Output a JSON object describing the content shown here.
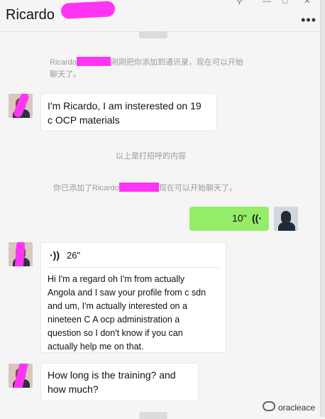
{
  "header": {
    "title": "Ricardo",
    "more_icon": "more-horizontal-icon",
    "window_controls": [
      "pin-icon",
      "minimize-icon",
      "maximize-icon",
      "close-icon"
    ]
  },
  "system_messages": [
    {
      "prefix": "Ricardo",
      "suffix": "刚刚把你添加到通讯录，现在可以开始",
      "line2": "聊天了。"
    },
    {
      "text": "以上是打招呼的内容"
    },
    {
      "prefix": "你已添加了Ricardo",
      "suffix": "现在可以开始聊天了。"
    }
  ],
  "messages": [
    {
      "sender": "Ricardo",
      "text_line1": "I'm Ricardo, I am insterested on 19",
      "text_line2": "c OCP materials"
    },
    {
      "sender": "me",
      "type": "voice",
      "duration": "10\""
    },
    {
      "sender": "Ricardo",
      "type": "voice",
      "duration": "26\"",
      "transcript": [
        "Hi I'm a regard oh I'm from actually",
        "Angola and I saw your profile from c sdn",
        "and um, I'm actually interested on a",
        "nineteen C A ocp administration a",
        "question so I don't know if you can",
        "actually help me on that."
      ]
    },
    {
      "sender": "Ricardo",
      "text_line1": "How long is the training? and",
      "text_line2": "how much?"
    }
  ],
  "watermark": {
    "text": "oracleace"
  },
  "colors": {
    "redaction": "#ff34f4",
    "own_bubble": "#95ec69",
    "background": "#f5f5f5"
  }
}
